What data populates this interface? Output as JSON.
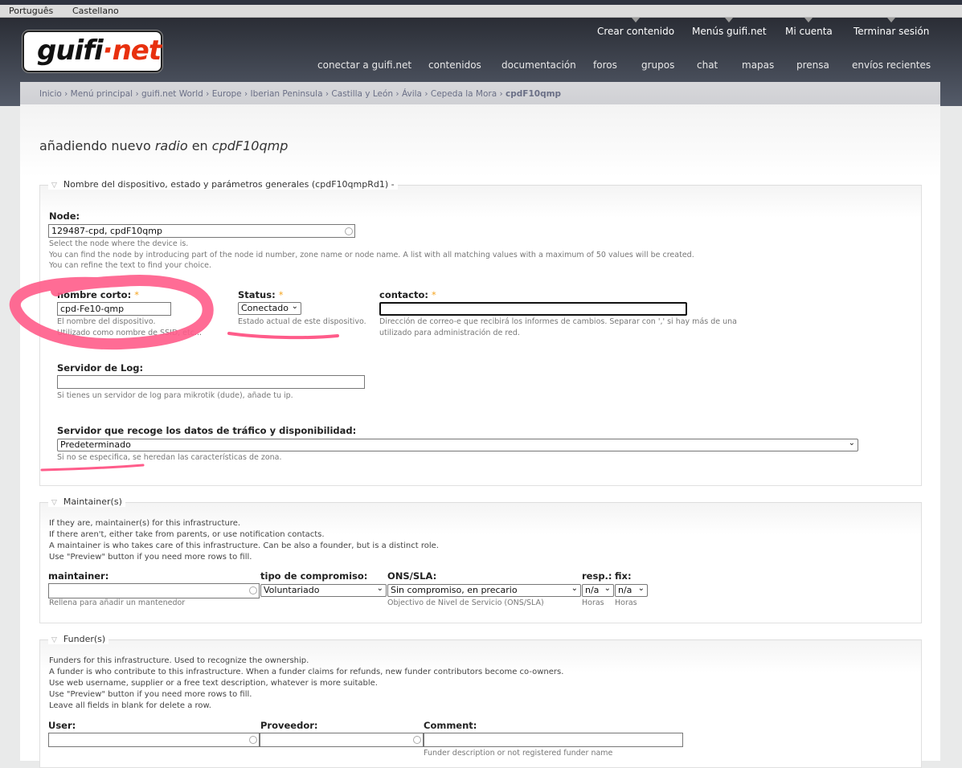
{
  "languages": [
    "Português",
    "Castellano"
  ],
  "logo": {
    "part1": "guifi",
    "part2": "·net"
  },
  "top_nav": [
    "Crear contenido",
    "Menús guifi.net",
    "Mi cuenta",
    "Terminar sesión"
  ],
  "main_nav": [
    "conectar a guifi.net",
    "contenidos",
    "documentación",
    "foros",
    "grupos",
    "chat",
    "mapas",
    "prensa",
    "envíos recientes"
  ],
  "breadcrumb": [
    "Inicio",
    "Menú principal",
    "guifi.net World",
    "Europe",
    "Iberian Peninsula",
    "Castilla y León",
    "Ávila",
    "Cepeda la Mora",
    "cpdF10qmp"
  ],
  "title": {
    "pre": "añadiendo nuevo ",
    "em1": "radio",
    "mid": " en ",
    "em2": "cpdF10qmp"
  },
  "general": {
    "legend": "Nombre del dispositivo, estado y parámetros generales (cpdF10qmpRd1) -",
    "node_label": "Node:",
    "node_value": "129487-cpd, cpdF10qmp",
    "node_desc": [
      "Select the node where the device is.",
      "You can find the node by introducing part of the node id number, zone name or node name. A list with all matching values with a maximum of 50 values will be created.",
      "You can refine the text to find your choice."
    ],
    "short_label": "nombre corto:",
    "short_value": "cpd-Fe10-qmp",
    "short_desc": [
      "El nombre del dispositivo.",
      "Utilizado como nombre de SSID, etc..."
    ],
    "status_label": "Status:",
    "status_value": "Conectado",
    "status_desc": "Estado actual de este dispositivo.",
    "contact_label": "contacto:",
    "contact_value": "",
    "contact_desc": [
      "Dirección de correo-e que recibirá los informes de cambios. Separar con ',' si hay más de una",
      "utilizado para administración de red."
    ],
    "required": "*",
    "log_label": "Servidor de Log:",
    "log_value": "",
    "log_desc": "Si tienes un servidor de log para mikrotik (dude), añade tu ip.",
    "traffic_label": "Servidor que recoge los datos de tráfico y disponibilidad:",
    "traffic_value": "Predeterminado",
    "traffic_desc": "Si no se especifica, se heredan las características de zona."
  },
  "maintainers": {
    "legend": "Maintainer(s)",
    "intro": [
      "If they are, maintainer(s) for this infrastructure.",
      "If there aren't, either take from parents, or use notification contacts.",
      "A maintainer is who takes care of this infrastructure. Can be also a founder, but is a distinct role.",
      "Use \"Preview\" button if you need more rows to fill."
    ],
    "maintainer_label": "maintainer:",
    "maintainer_value": "",
    "maintainer_desc": "Rellena para añadir un mantenedor",
    "commit_label": "tipo de compromiso:",
    "commit_value": "Voluntariado",
    "sla_label": "ONS/SLA:",
    "sla_value": "Sin compromiso, en precario",
    "sla_desc": "Objectivo de Nivel de Servicio (ONS/SLA)",
    "resp_label": "resp.:",
    "resp_value": "n/a",
    "resp_desc": "Horas",
    "fix_label": "fix:",
    "fix_value": "n/a",
    "fix_desc": "Horas"
  },
  "funders": {
    "legend": "Funder(s)",
    "intro": [
      "Funders for this infrastructure. Used to recognize the ownership.",
      "A funder is who contribute to this infrastructure. When a funder claims for refunds, new funder contributors become co-owners.",
      "Use web username, supplier or a free text description, whatever is more suitable.",
      "Use \"Preview\" button if you need more rows to fill.",
      "Leave all fields in blank for delete a row."
    ],
    "user_label": "User:",
    "user_value": "",
    "supplier_label": "Proveedor:",
    "supplier_value": "",
    "comment_label": "Comment:",
    "comment_value": "",
    "comment_desc": "Funder description or not registered funder name"
  },
  "annotation_color": "#ff5c8a"
}
